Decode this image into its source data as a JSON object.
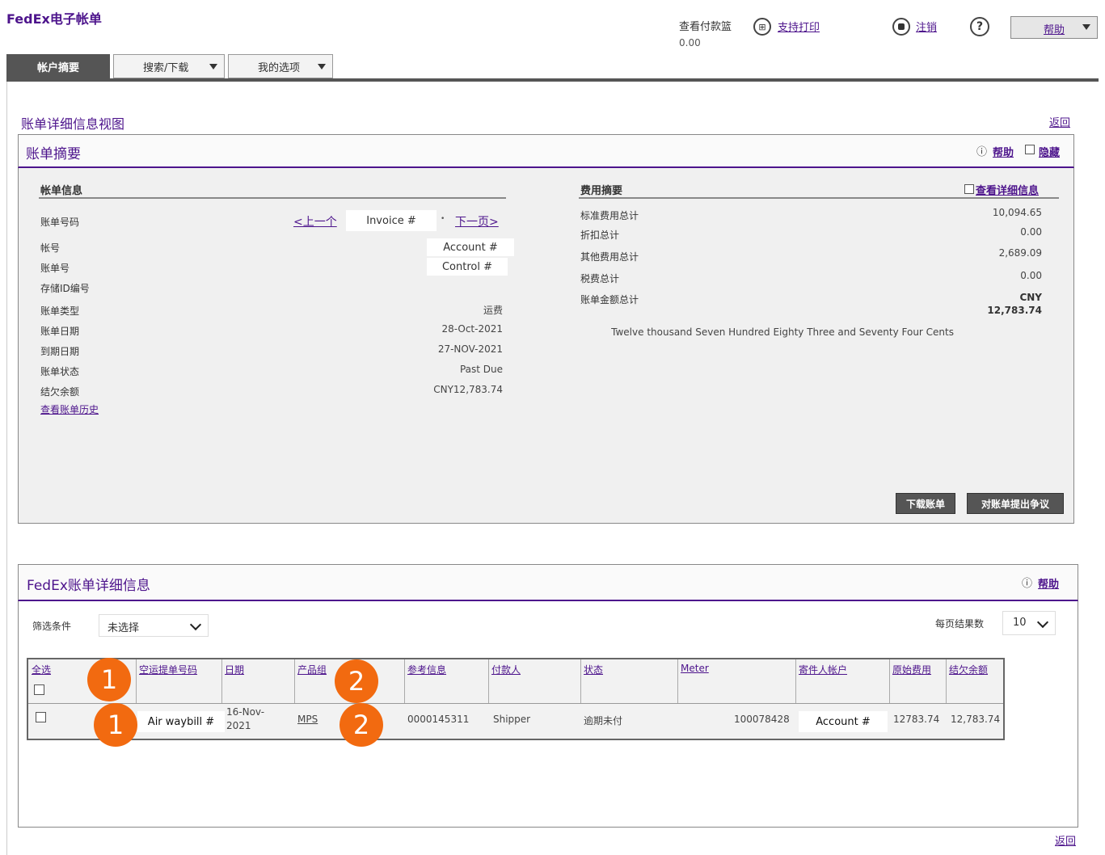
{
  "header": {
    "app_title": "FedEx电子帐单",
    "balance_label": "查看付款篮",
    "balance_value": "0.00",
    "print_icon_glyph": "⊞",
    "print_label": "支持打印",
    "logout_label": "注销",
    "help_icon_glyph": "?",
    "help_label": "帮助"
  },
  "tabs": [
    {
      "label": "帐户摘要"
    },
    {
      "label": "搜索/下载"
    },
    {
      "label": "我的选项"
    }
  ],
  "page": {
    "title": "账单详细信息视图",
    "back_label": "返回"
  },
  "summary": {
    "title": "账单摘要",
    "help_label": "帮助",
    "hide_label": "隐藏",
    "bill_info_heading": "帐单信息",
    "prev_label": "<上一个",
    "next_label": "下一页>",
    "invoice_placeholder": "Invoice #",
    "account_placeholder": "Account #",
    "control_placeholder": "Control #",
    "labels": {
      "invoice_number": "账单号码",
      "account": "帐号",
      "bill_no": "账单号",
      "storage_id": "存储ID编号",
      "bill_type": "账单类型",
      "bill_date": "账单日期",
      "due_date": "到期日期",
      "bill_status": "账单状态",
      "balance_due": "结欠余额"
    },
    "values": {
      "bill_type": "运费",
      "bill_date": "28-Oct-2021",
      "due_date": "27-NOV-2021",
      "bill_status": "Past Due",
      "balance_due": "CNY12,783.74"
    },
    "history_link": "查看账单历史",
    "fee_heading": "费用摘要",
    "fee_detail_link": "查看详细信息",
    "fees": {
      "standard_label": "标准费用总计",
      "standard_value": "10,094.65",
      "discount_label": "折扣总计",
      "discount_value": "0.00",
      "other_label": "其他费用总计",
      "other_value": "2,689.09",
      "tax_label": "税费总计",
      "tax_value": "0.00",
      "total_label": "账单金额总计",
      "total_currency": "CNY",
      "total_value": "12,783.74"
    },
    "amount_words": "Twelve thousand Seven Hundred Eighty Three and Seventy Four Cents",
    "download_button": "下载账单",
    "dispute_button": "对账单提出争议"
  },
  "details": {
    "title": "FedEx账单详细信息",
    "help_label": "帮助",
    "filter_label": "筛选条件",
    "filter_value": "未选择",
    "per_page_label": "每页结果数",
    "per_page_value": "10",
    "columns": [
      "全选",
      "空运提单号码",
      "日期",
      "产品组",
      "参考信息",
      "付款人",
      "状态",
      "Meter",
      "寄件人帐户",
      "原始费用",
      "结欠余额"
    ],
    "row": {
      "airbill_placeholder": "Air waybill #",
      "date": "16-Nov-2021",
      "product": "MPS",
      "reference": "0000145311",
      "payer": "Shipper",
      "status": "逾期未付",
      "meter": "100078428",
      "shipper_account_placeholder": "Account #",
      "original_charge": "12783.74",
      "balance_due": "12,783.74"
    },
    "badges": [
      "1",
      "2"
    ]
  },
  "colors": {
    "brand_purple": "#4d148c",
    "badge_orange": "#f26a10"
  }
}
